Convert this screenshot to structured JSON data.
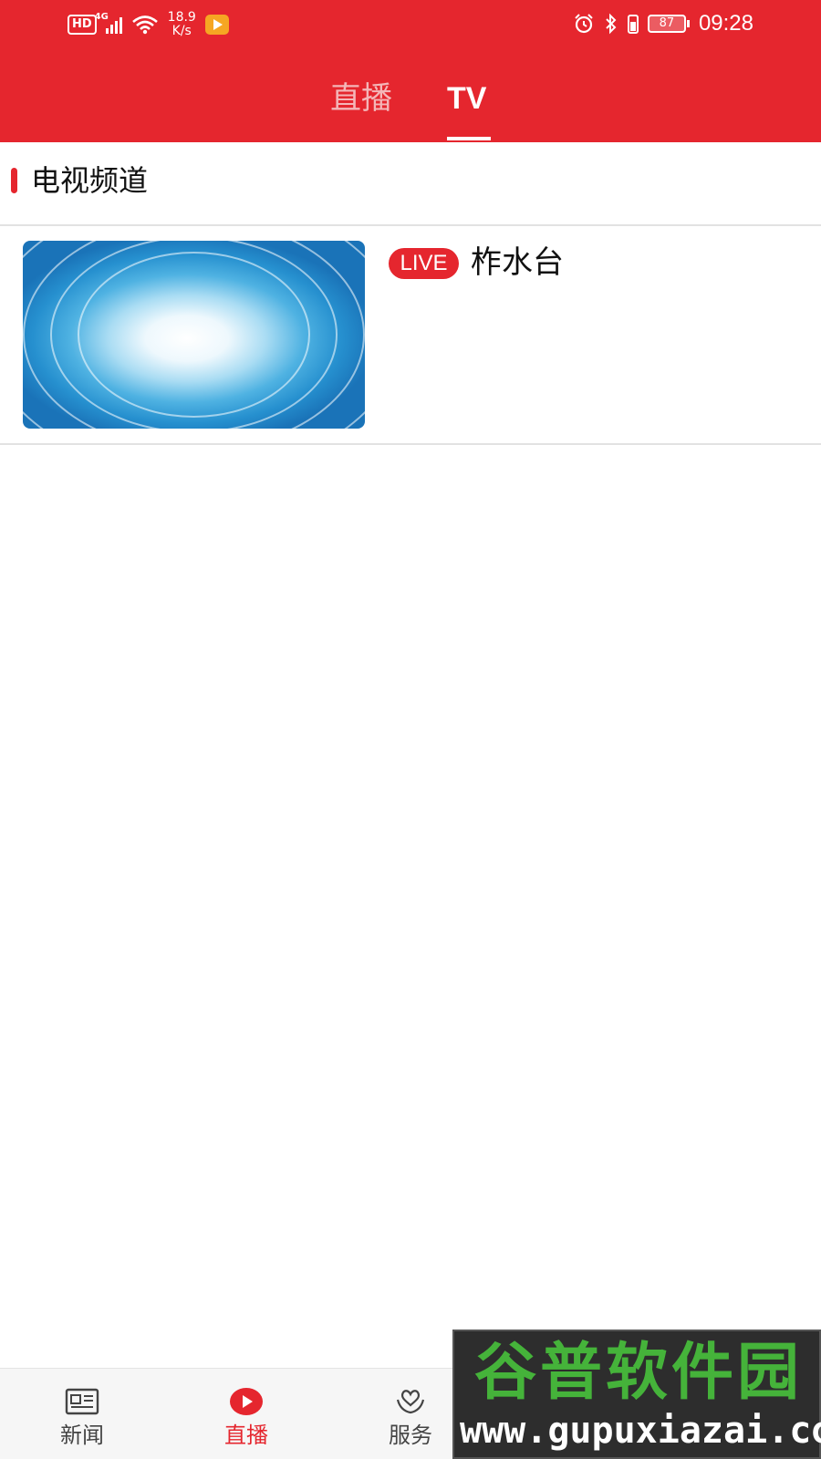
{
  "status_bar": {
    "hd": "HD",
    "network": "4G",
    "speed_value": "18.9",
    "speed_unit": "K/s",
    "battery": "87",
    "time": "09:28",
    "icons": [
      "hd-icon",
      "signal-icon",
      "wifi-icon",
      "app-icon",
      "alarm-icon",
      "bluetooth-icon",
      "battery-icon"
    ]
  },
  "top_tabs": [
    {
      "label": "直播",
      "active": false
    },
    {
      "label": "TV",
      "active": true
    }
  ],
  "section": {
    "title": "电视频道"
  },
  "channels": [
    {
      "badge": "LIVE",
      "name": "柞水台"
    }
  ],
  "bottom_nav": [
    {
      "label": "新闻",
      "icon": "newspaper-icon",
      "active": false
    },
    {
      "label": "直播",
      "icon": "play-icon",
      "active": true
    },
    {
      "label": "服务",
      "icon": "heart-hand-icon",
      "active": false
    },
    {
      "label": "",
      "icon": "circle-icon",
      "active": false
    },
    {
      "label": "",
      "icon": "user-icon",
      "active": false
    }
  ],
  "watermark": {
    "title": "谷普软件园",
    "url": "www.gupuxiazai.com"
  },
  "colors": {
    "brand_red": "#e5262e",
    "inactive_tab": "#f4b6b8",
    "divider": "#e2e2e2"
  }
}
